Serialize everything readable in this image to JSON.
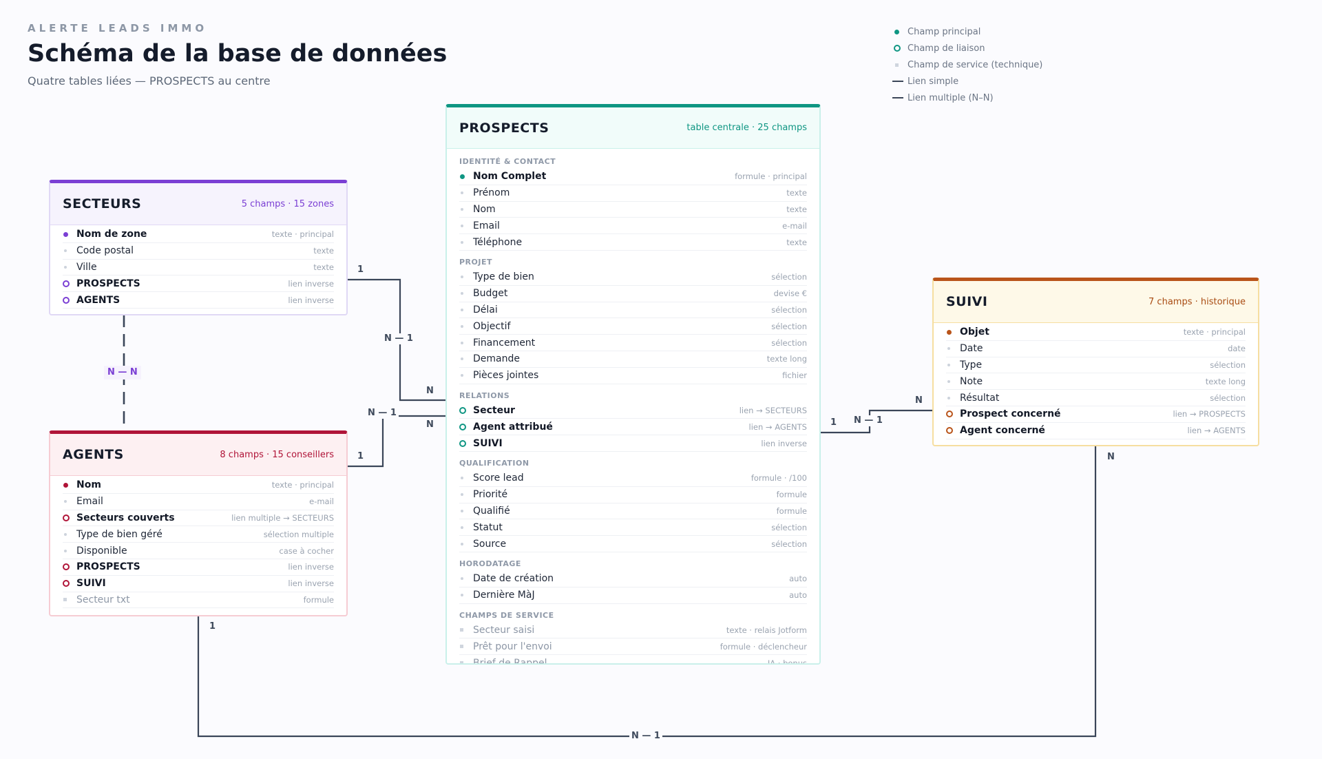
{
  "header": {
    "eyebrow": "ALERTE LEADS IMMO",
    "title": "Schéma de la base de données",
    "subtitle": "Quatre tables liées — PROSPECTS au centre"
  },
  "legend": [
    {
      "kind": "primary",
      "label": "Champ principal"
    },
    {
      "kind": "link",
      "label": "Champ de liaison"
    },
    {
      "kind": "service",
      "label": "Champ de service (technique)"
    },
    {
      "kind": "line",
      "label": "Lien simple"
    },
    {
      "kind": "line",
      "label": "Lien multiple (N–N)"
    }
  ],
  "colors": {
    "prospects": "#0f9683",
    "secteurs": "#7b3fd4",
    "agents": "#b01438",
    "suivi": "#b9541a",
    "connector": "#3a4558"
  },
  "tables": {
    "prospects": {
      "name": "PROSPECTS",
      "meta": "table centrale · 25 champs",
      "sections": [
        {
          "title": "IDENTITÉ & CONTACT",
          "fields": [
            {
              "name": "Nom Complet",
              "type": "formule · principal",
              "kind": "primary"
            },
            {
              "name": "Prénom",
              "type": "texte",
              "kind": "plain"
            },
            {
              "name": "Nom",
              "type": "texte",
              "kind": "plain"
            },
            {
              "name": "Email",
              "type": "e-mail",
              "kind": "plain"
            },
            {
              "name": "Téléphone",
              "type": "texte",
              "kind": "plain"
            }
          ]
        },
        {
          "title": "PROJET",
          "fields": [
            {
              "name": "Type de bien",
              "type": "sélection",
              "kind": "plain"
            },
            {
              "name": "Budget",
              "type": "devise €",
              "kind": "plain"
            },
            {
              "name": "Délai",
              "type": "sélection",
              "kind": "plain"
            },
            {
              "name": "Objectif",
              "type": "sélection",
              "kind": "plain"
            },
            {
              "name": "Financement",
              "type": "sélection",
              "kind": "plain"
            },
            {
              "name": "Demande",
              "type": "texte long",
              "kind": "plain"
            },
            {
              "name": "Pièces jointes",
              "type": "fichier",
              "kind": "plain"
            }
          ]
        },
        {
          "title": "RELATIONS",
          "fields": [
            {
              "name": "Secteur",
              "type": "lien → SECTEURS",
              "kind": "link"
            },
            {
              "name": "Agent attribué",
              "type": "lien → AGENTS",
              "kind": "link"
            },
            {
              "name": "SUIVI",
              "type": "lien inverse",
              "kind": "link"
            }
          ]
        },
        {
          "title": "QUALIFICATION",
          "fields": [
            {
              "name": "Score lead",
              "type": "formule · /100",
              "kind": "plain"
            },
            {
              "name": "Priorité",
              "type": "formule",
              "kind": "plain"
            },
            {
              "name": "Qualifié",
              "type": "formule",
              "kind": "plain"
            },
            {
              "name": "Statut",
              "type": "sélection",
              "kind": "plain"
            },
            {
              "name": "Source",
              "type": "sélection",
              "kind": "plain"
            }
          ]
        },
        {
          "title": "HORODATAGE",
          "fields": [
            {
              "name": "Date de création",
              "type": "auto",
              "kind": "plain"
            },
            {
              "name": "Dernière MàJ",
              "type": "auto",
              "kind": "plain"
            }
          ]
        },
        {
          "title": "CHAMPS DE SERVICE",
          "fields": [
            {
              "name": "Secteur saisi",
              "type": "texte · relais Jotform",
              "kind": "service"
            },
            {
              "name": "Prêt pour l'envoi",
              "type": "formule · déclencheur",
              "kind": "service"
            },
            {
              "name": "Brief de Rappel",
              "type": "IA · bonus",
              "kind": "service"
            }
          ]
        }
      ]
    },
    "secteurs": {
      "name": "SECTEURS",
      "meta": "5 champs · 15 zones",
      "sections": [
        {
          "title": "",
          "fields": [
            {
              "name": "Nom de zone",
              "type": "texte · principal",
              "kind": "primary"
            },
            {
              "name": "Code postal",
              "type": "texte",
              "kind": "plain"
            },
            {
              "name": "Ville",
              "type": "texte",
              "kind": "plain"
            },
            {
              "name": "PROSPECTS",
              "type": "lien inverse",
              "kind": "link"
            },
            {
              "name": "AGENTS",
              "type": "lien inverse",
              "kind": "link"
            }
          ]
        }
      ]
    },
    "agents": {
      "name": "AGENTS",
      "meta": "8 champs · 15 conseillers",
      "sections": [
        {
          "title": "",
          "fields": [
            {
              "name": "Nom",
              "type": "texte · principal",
              "kind": "primary"
            },
            {
              "name": "Email",
              "type": "e-mail",
              "kind": "plain"
            },
            {
              "name": "Secteurs couverts",
              "type": "lien multiple → SECTEURS",
              "kind": "link"
            },
            {
              "name": "Type de bien géré",
              "type": "sélection multiple",
              "kind": "plain"
            },
            {
              "name": "Disponible",
              "type": "case à cocher",
              "kind": "plain"
            },
            {
              "name": "PROSPECTS",
              "type": "lien inverse",
              "kind": "link"
            },
            {
              "name": "SUIVI",
              "type": "lien inverse",
              "kind": "link"
            },
            {
              "name": "Secteur txt",
              "type": "formule",
              "kind": "service"
            }
          ]
        }
      ]
    },
    "suivi": {
      "name": "SUIVI",
      "meta": "7 champs · historique",
      "sections": [
        {
          "title": "",
          "fields": [
            {
              "name": "Objet",
              "type": "texte · principal",
              "kind": "primary"
            },
            {
              "name": "Date",
              "type": "date",
              "kind": "plain"
            },
            {
              "name": "Type",
              "type": "sélection",
              "kind": "plain"
            },
            {
              "name": "Note",
              "type": "texte long",
              "kind": "plain"
            },
            {
              "name": "Résultat",
              "type": "sélection",
              "kind": "plain"
            },
            {
              "name": "Prospect concerné",
              "type": "lien → PROSPECTS",
              "kind": "link"
            },
            {
              "name": "Agent concerné",
              "type": "lien → AGENTS",
              "kind": "link"
            }
          ]
        }
      ]
    }
  },
  "relations": {
    "secteurs_prospects": {
      "label": "N — 1",
      "card_from": "1",
      "card_to": "N"
    },
    "agents_prospects": {
      "label": "N — 1",
      "card_from": "1",
      "card_to": "N"
    },
    "secteurs_agents": {
      "label": "N — N"
    },
    "suivi_prospects": {
      "label": "N — 1",
      "card_from": "1",
      "card_to": "N"
    },
    "agents_suivi": {
      "label": "N — 1",
      "card_from": "1",
      "card_to": "N"
    }
  }
}
